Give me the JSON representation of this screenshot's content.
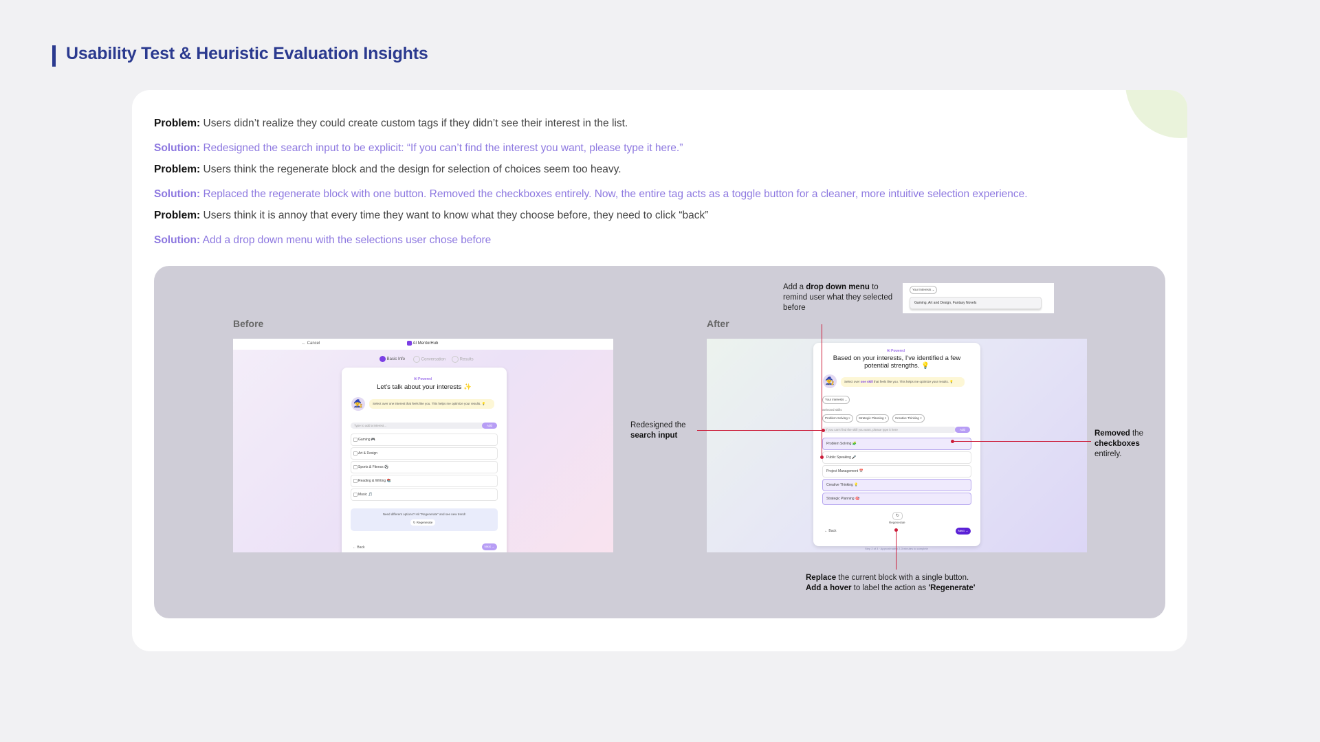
{
  "page": {
    "title": "Usability Test & Heuristic Evaluation Insights"
  },
  "insights": [
    {
      "label": "Problem:",
      "text": "Users didn’t realize they could create custom tags if they didn’t see their interest in the list."
    },
    {
      "label": "Solution:",
      "text": "Redesigned the search input to be explicit: “If you can’t find the interest you want, please type it here.”"
    },
    {
      "label": "Problem:",
      "text": "Users think the regenerate block and the design for selection of choices seem too heavy."
    },
    {
      "label": "Solution:",
      "text": "Replaced the regenerate block with one button. Removed the checkboxes entirely. Now, the entire tag acts as a toggle button for a cleaner, more intuitive selection experience."
    },
    {
      "label": "Problem:",
      "text": " Users think  it is annoy that every time they want to know what they choose before, they need to click “back”"
    },
    {
      "label": "Solution:",
      "text": "Add a drop down menu with the selections user chose before"
    }
  ],
  "before": {
    "label": "Before",
    "cancel": "Cancel",
    "brand": "AI MentorHub",
    "steps": [
      "Basic Info",
      "Conversation",
      "Results"
    ],
    "ai_tag": "AI Powered",
    "heading": "Let's talk about your interests ✨",
    "bubble": "Select over one interest that feels like you. This helps me optimize your results. 💡",
    "search_placeholder": "Type to add a interest...",
    "add_label": "Add",
    "options": [
      "Gaming 🎮",
      "Art & Design",
      "Sports & Fitness ⚽",
      "Reading & Writing 📚",
      "Music 🎵"
    ],
    "regen_text": "Need different options? Hit “Regenerate” and see new trend!",
    "regen_button": "Regenerate",
    "back": "Back",
    "next": "Next"
  },
  "after": {
    "label": "After",
    "ai_tag": "AI Powered",
    "heading": "Based on your interests, I've identified a few potential strengths. 💡",
    "bubble_pre": "Select over ",
    "bubble_em": "one skill",
    "bubble_post": " that feels like you. This helps me optimize your results. 💡",
    "interests_toggle": "Your interests",
    "selected_label": "Selected skills",
    "chips": [
      "Problem Solving ×",
      "Strategic Planning ×",
      "Creative Thinking ×"
    ],
    "search_placeholder": "If you can't find the skill you want, please type it here",
    "add_label": "Add",
    "options": [
      {
        "text": "Problem Solving 🧩",
        "selected": true
      },
      {
        "text": "Public Speaking 🎤",
        "selected": false
      },
      {
        "text": "Project Management 📅",
        "selected": false
      },
      {
        "text": "Creative Thinking 💡",
        "selected": true
      },
      {
        "text": "Strategic Planning 🎯",
        "selected": true
      }
    ],
    "regen_label": "Regenerate",
    "back": "Back",
    "next": "Next",
    "footer": "Step 2 of 3 · Approximately 2-3 minutes to complete"
  },
  "dropdown_preview": {
    "toggle": "Your interests",
    "value": "Gaming, Art and Design, Fantasy Novels"
  },
  "annotations": {
    "dropdown": {
      "pre": "Add a ",
      "bold": "drop down menu",
      "post": " to remind user what they selected before"
    },
    "search": {
      "line1": "Redesigned the",
      "bold": "search input"
    },
    "checkbox": {
      "bold1": "Removed",
      "mid": " the",
      "bold2": "checkboxes",
      "post": "entirely."
    },
    "regen": {
      "bold1": "Replace",
      "text1": " the current block with a single button.",
      "bold2": "Add a hover",
      "text2": " to  label the action as ",
      "bold3": "'Regenerate'"
    }
  },
  "colors": {
    "title": "#2b3a8f",
    "solution": "#8d78e0",
    "annotation_line": "#cc1d3a",
    "showcase_bg": "#cfcdd7",
    "accent_purple": "#7b3fe4"
  }
}
